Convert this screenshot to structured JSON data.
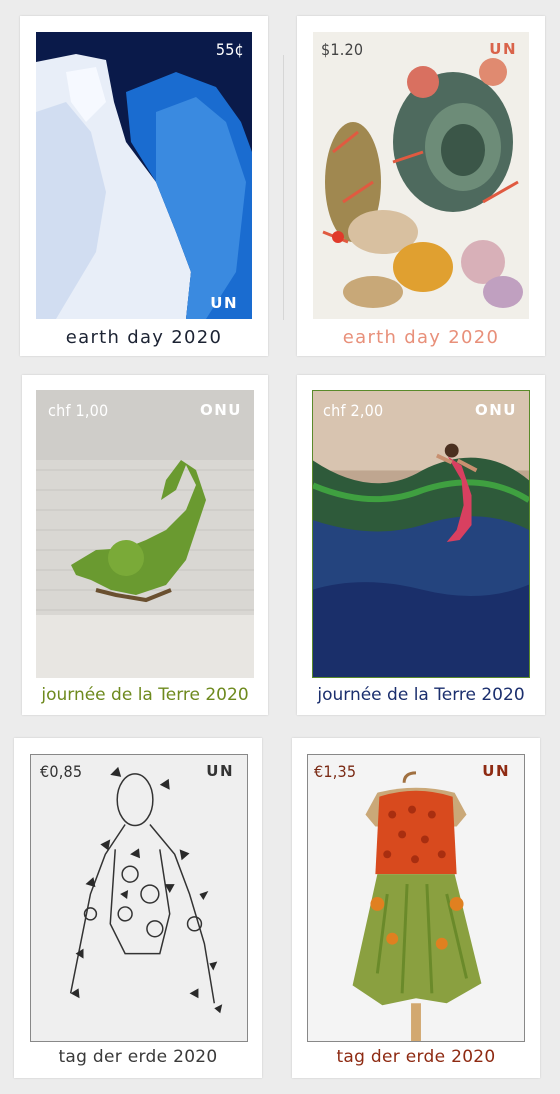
{
  "stamps": [
    {
      "value": "55¢",
      "issuer": "UN",
      "caption": "earth day 2020",
      "caption_color": "#1c2333",
      "value_color": "#ffffff",
      "issuer_color": "#ffffff",
      "artwork": "glacier-ice"
    },
    {
      "value": "$1.20",
      "issuer": "UN",
      "caption": "earth day 2020",
      "caption_color": "#e8907a",
      "value_color": "#444444",
      "issuer_color": "#d9634a",
      "artwork": "coral-reef"
    },
    {
      "value": "chf 1,00",
      "issuer": "ONU",
      "caption": "journée de la Terre 2020",
      "caption_color": "#6e8a1e",
      "value_color": "#ffffff",
      "issuer_color": "#ffffff",
      "artwork": "grass-figure"
    },
    {
      "value": "chf 2,00",
      "issuer": "ONU",
      "caption": "journée de la Terre 2020",
      "caption_color": "#1b2f6e",
      "value_color": "#ffffff",
      "issuer_color": "#ffffff",
      "artwork": "mermaid-plastic"
    },
    {
      "value": "€0,85",
      "issuer": "UN",
      "caption": "tag der erde 2020",
      "caption_color": "#3a3a3a",
      "value_color": "#333333",
      "issuer_color": "#333333",
      "artwork": "metal-butterfly-figure"
    },
    {
      "value": "€1,35",
      "issuer": "UN",
      "caption": "tag der erde 2020",
      "caption_color": "#8e2a12",
      "value_color": "#7a2a14",
      "issuer_color": "#8e2a12",
      "artwork": "flower-dress"
    }
  ]
}
